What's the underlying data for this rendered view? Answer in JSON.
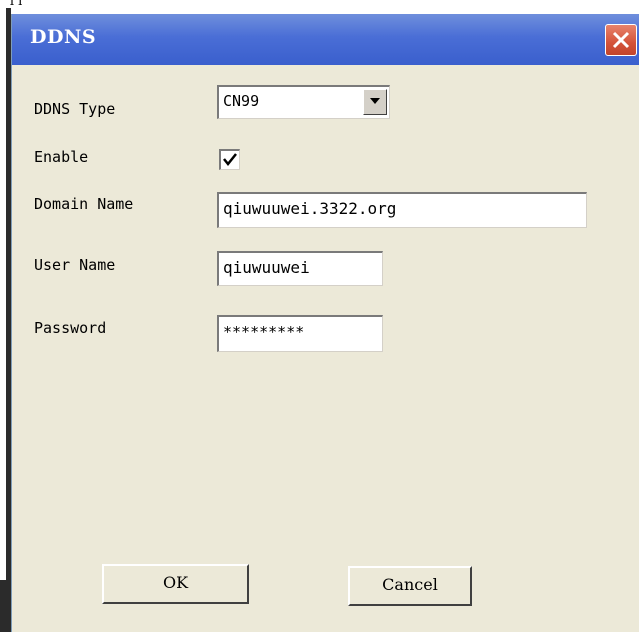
{
  "stray_text": "TT",
  "dialog": {
    "title": "DDNS",
    "close_glyph": "×"
  },
  "form": {
    "ddns_type": {
      "label": "DDNS Type",
      "value": "CN99"
    },
    "enable": {
      "label": "Enable",
      "checked": true
    },
    "domain_name": {
      "label": "Domain Name",
      "value": "qiuwuuwei.3322.org"
    },
    "user_name": {
      "label": "User Name",
      "value": "qiuwuuwei"
    },
    "password": {
      "label": "Password",
      "value": "*********"
    }
  },
  "buttons": {
    "ok_label": "OK",
    "cancel_label": "Cancel"
  },
  "colors": {
    "titlebar": "#3a5fcd",
    "dialog_bg": "#ece9d8",
    "close_button": "#d4533a"
  },
  "icons": {
    "close": "close-icon",
    "dropdown": "chevron-down-icon",
    "check": "checkmark-icon"
  }
}
